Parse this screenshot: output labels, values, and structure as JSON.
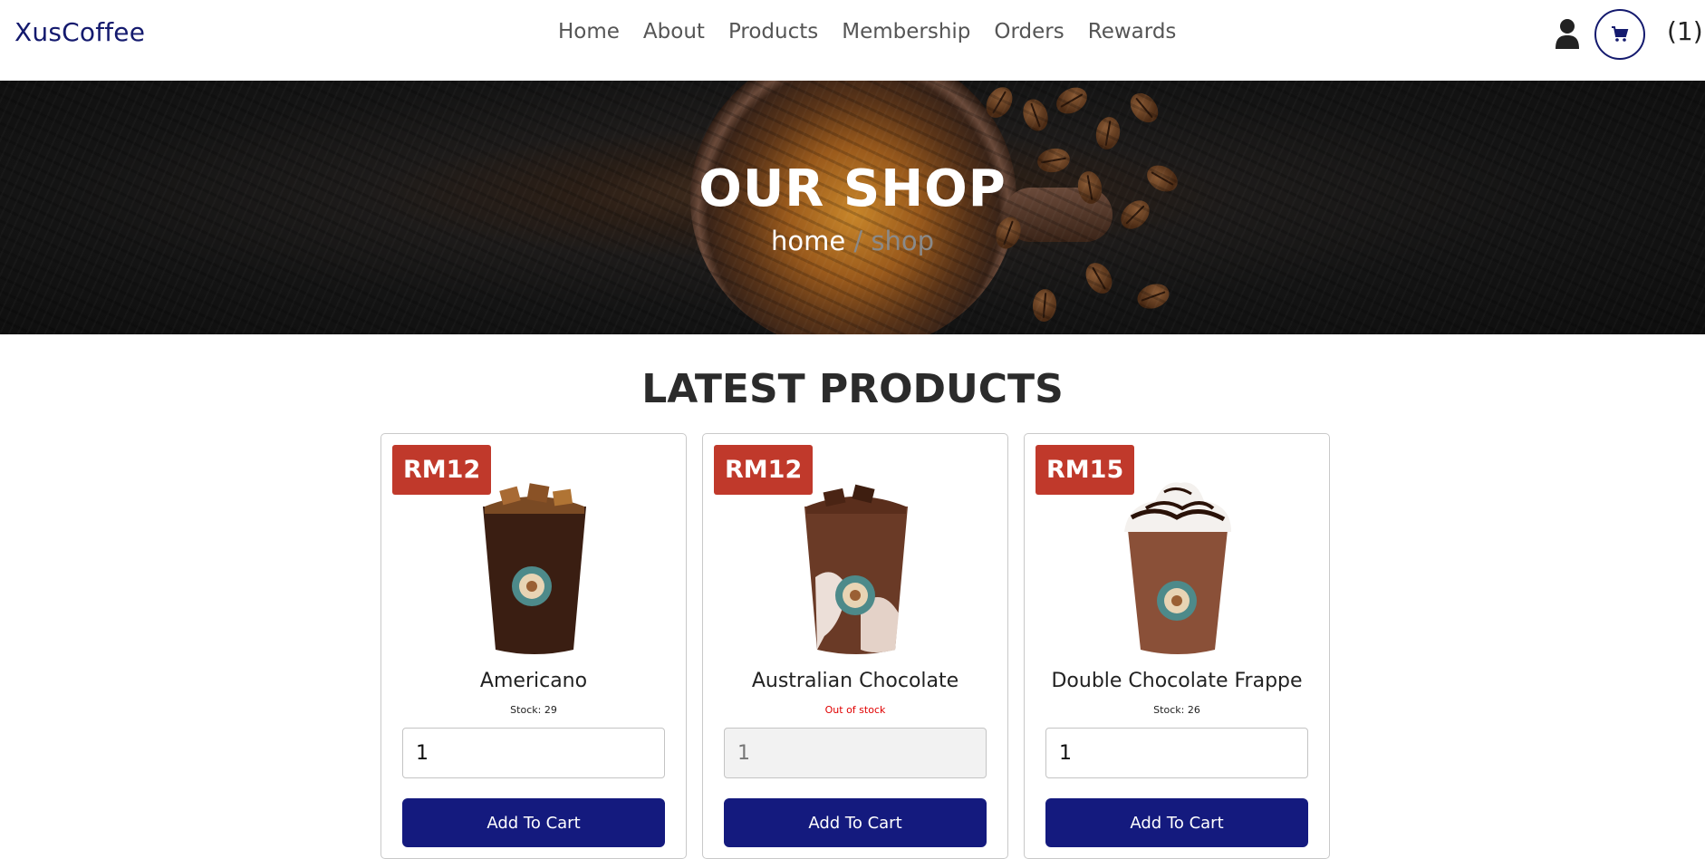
{
  "navbar": {
    "brand": "XusCoffee",
    "links": [
      "Home",
      "About",
      "Products",
      "Membership",
      "Orders",
      "Rewards"
    ],
    "cart_count": "(1)",
    "user_icon": "user-icon",
    "cart_icon": "cart-icon"
  },
  "hero": {
    "title": "OUR SHOP",
    "breadcrumb": {
      "home": "home",
      "separator": "/",
      "current": "shop"
    }
  },
  "section": {
    "title": "LATEST PRODUCTS"
  },
  "products": [
    {
      "price": "RM12",
      "name": "Americano",
      "stock": "Stock: 29",
      "in_stock": true,
      "quantity": "1",
      "button": "Add To Cart"
    },
    {
      "price": "RM12",
      "name": "Australian Chocolate",
      "stock": "Out of stock",
      "in_stock": false,
      "quantity": "1",
      "button": "Add To Cart"
    },
    {
      "price": "RM15",
      "name": "Double Chocolate Frappe",
      "stock": "Stock: 26",
      "in_stock": true,
      "quantity": "1",
      "button": "Add To Cart"
    }
  ],
  "colors": {
    "brand": "#141a6e",
    "price_badge": "#c0392b",
    "button": "#141a7e",
    "out_of_stock": "#e00000"
  }
}
